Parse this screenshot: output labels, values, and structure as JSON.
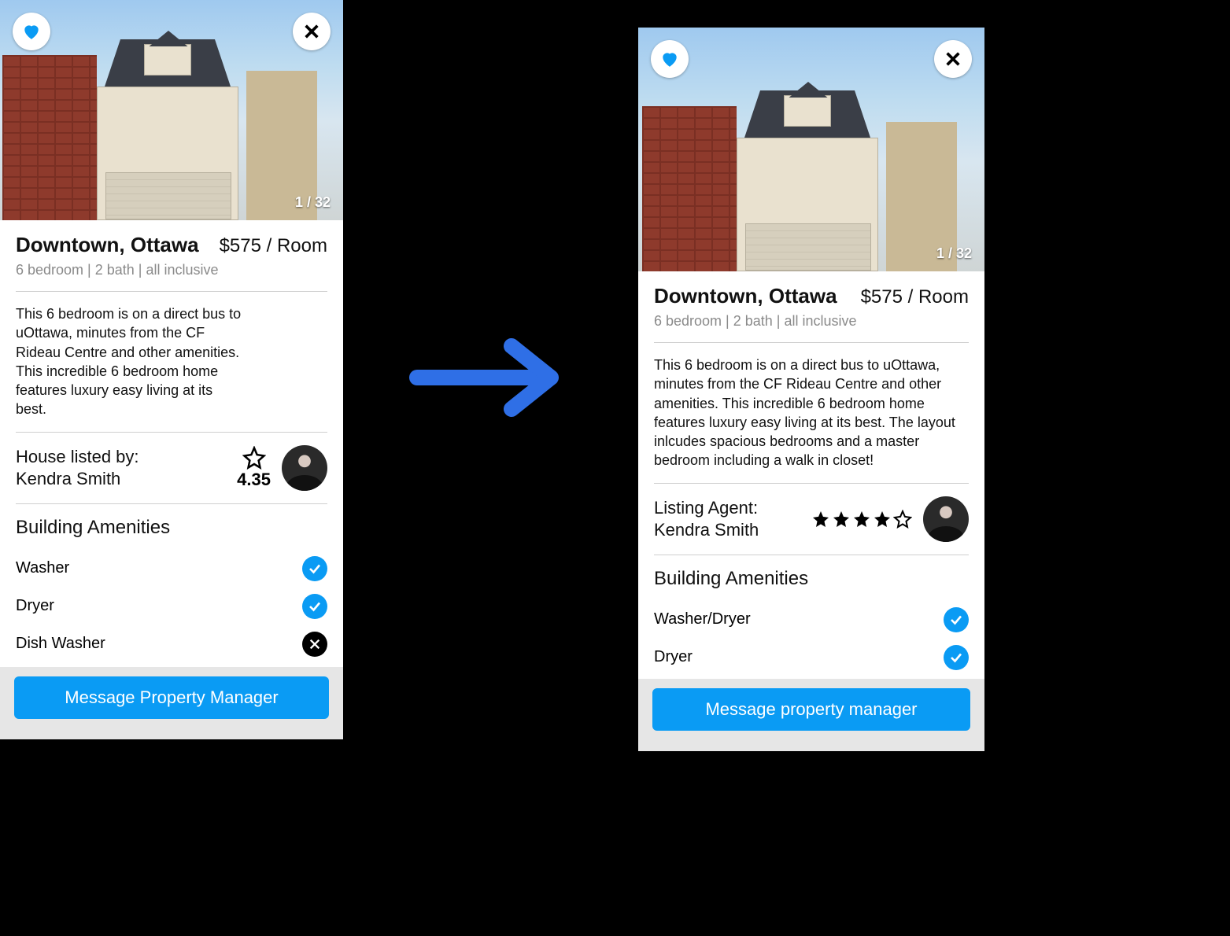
{
  "left": {
    "photo_counter": "1 / 32",
    "title": "Downtown, Ottawa",
    "price": "$575 / Room",
    "subtitle": "6 bedroom | 2 bath | all inclusive",
    "description": "This 6 bedroom is on a direct bus to uOttawa, minutes from the CF Rideau Centre and other amenities. This incredible 6 bedroom home features luxury easy living at its best.",
    "agent_label": "House listed by:",
    "agent_name": "Kendra Smith",
    "rating": "4.35",
    "amenities_heading": "Building Amenities",
    "amenities": [
      {
        "label": "Washer",
        "status": "check"
      },
      {
        "label": "Dryer",
        "status": "check"
      },
      {
        "label": "Dish Washer",
        "status": "x"
      }
    ],
    "cta": "Message Property Manager"
  },
  "right": {
    "photo_counter": "1 / 32",
    "title": "Downtown, Ottawa",
    "price": "$575 / Room",
    "subtitle": "6 bedroom | 2 bath | all inclusive",
    "description": "This 6 bedroom is on a direct bus to uOttawa, minutes from the CF Rideau Centre and other amenities. This incredible 6 bedroom home features luxury easy living at its best. The layout inlcudes spacious bedrooms and a master bedroom including a walk in closet!",
    "agent_label": "Listing Agent:",
    "agent_name": "Kendra Smith",
    "rating_stars": {
      "filled": 4,
      "total": 5
    },
    "amenities_heading": "Building Amenities",
    "amenities": [
      {
        "label": "Washer/Dryer",
        "status": "check"
      },
      {
        "label": "Dryer",
        "status": "check"
      }
    ],
    "cta": "Message property manager"
  },
  "colors": {
    "accent": "#0a9bf4"
  }
}
